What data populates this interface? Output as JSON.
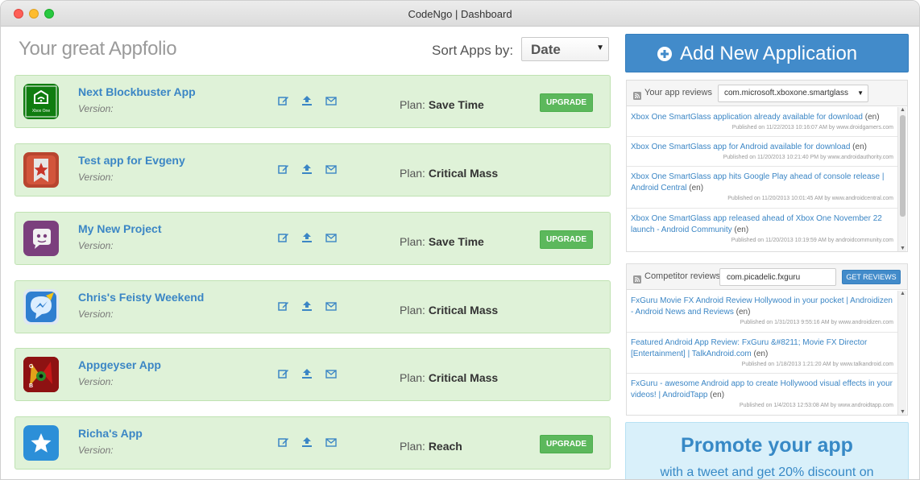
{
  "window": {
    "title": "CodeNgo | Dashboard"
  },
  "page": {
    "title": "Your great Appfolio",
    "sort_label": "Sort Apps by:",
    "sort_value": "Date"
  },
  "apps": [
    {
      "name": "Next Blockbuster App",
      "version_label": "Version:",
      "plan_label": "Plan:",
      "plan": "Save Time",
      "upgrade": "UPGRADE",
      "icon": "xbox-one-icon"
    },
    {
      "name": "Test app for Evgeny",
      "version_label": "Version:",
      "plan_label": "Plan:",
      "plan": "Critical Mass",
      "upgrade": "",
      "icon": "star-bookmark-icon"
    },
    {
      "name": "My New Project",
      "version_label": "Version:",
      "plan_label": "Plan:",
      "plan": "Save Time",
      "upgrade": "UPGRADE",
      "icon": "chat-robot-icon"
    },
    {
      "name": "Chris's Feisty Weekend",
      "version_label": "Version:",
      "plan_label": "Plan:",
      "plan": "Critical Mass",
      "upgrade": "",
      "icon": "messenger-icon"
    },
    {
      "name": "Appgeyser App",
      "version_label": "Version:",
      "plan_label": "Plan:",
      "plan": "Critical Mass",
      "upgrade": "",
      "icon": "game-art-icon"
    },
    {
      "name": "Richa's App",
      "version_label": "Version:",
      "plan_label": "Plan:",
      "plan": "Reach",
      "upgrade": "UPGRADE",
      "icon": "star-icon"
    }
  ],
  "add_button": {
    "label": "Add New Application"
  },
  "app_reviews": {
    "title": "Your app reviews",
    "package": "com.microsoft.xboxone.smartglass",
    "items": [
      {
        "title": "Xbox One SmartGlass application already available for download",
        "lang": "(en)",
        "meta": "Published on 11/22/2013 10:16:07 AM by www.droidgamers.com"
      },
      {
        "title": "Xbox One SmartGlass app for Android available for download",
        "lang": "(en)",
        "meta": "Published on 11/20/2013 10:21:40 PM by www.androidauthority.com"
      },
      {
        "title": "Xbox One SmartGlass app hits Google Play ahead of console release | Android Central",
        "lang": "(en)",
        "meta": "Published on 11/20/2013 10:01:45 AM by www.androidcentral.com"
      },
      {
        "title": "Xbox One SmartGlass app released ahead of Xbox One November 22 launch - Android Community",
        "lang": "(en)",
        "meta": "Published on 11/20/2013 10:19:59 AM by androidcommunity.com"
      }
    ]
  },
  "competitor_reviews": {
    "title": "Competitor reviews",
    "package": "com.picadelic.fxguru",
    "button": "GET REVIEWS",
    "items": [
      {
        "title": "FxGuru Movie FX Android Review Hollywood in your pocket | Androidizen - Android News and Reviews",
        "lang": "(en)",
        "meta": "Published on 1/31/2013 9:55:16 AM by www.androidizen.com"
      },
      {
        "title": "Featured Android App Review: FxGuru &#8211; Movie FX Director [Entertainment] | TalkAndroid.com",
        "lang": "(en)",
        "meta": "Published on 1/18/2013 1:21:20 AM by www.talkandroid.com"
      },
      {
        "title": "FxGuru - awesome Android app to create Hollywood visual effects in your videos! | AndroidTapp",
        "lang": "(en)",
        "meta": "Published on 1/4/2013 12:53:08 AM by www.androidtapp.com"
      }
    ]
  },
  "promo": {
    "title": "Promote your app",
    "subtitle": "with a tweet and get 20% discount on"
  },
  "colors": {
    "card_bg": "#dff2d8",
    "link_blue": "#3b86c5",
    "primary": "#428bca",
    "success": "#5cb85c",
    "promo_bg": "#d9f0fa"
  }
}
